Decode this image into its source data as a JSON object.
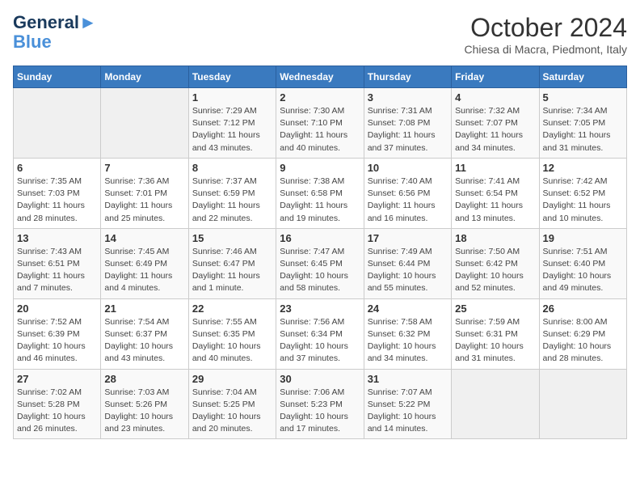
{
  "header": {
    "logo_line1": "General",
    "logo_line2": "Blue",
    "title": "October 2024",
    "location": "Chiesa di Macra, Piedmont, Italy"
  },
  "columns": [
    "Sunday",
    "Monday",
    "Tuesday",
    "Wednesday",
    "Thursday",
    "Friday",
    "Saturday"
  ],
  "weeks": [
    [
      {
        "day": "",
        "sunrise": "",
        "sunset": "",
        "daylight": ""
      },
      {
        "day": "",
        "sunrise": "",
        "sunset": "",
        "daylight": ""
      },
      {
        "day": "1",
        "sunrise": "Sunrise: 7:29 AM",
        "sunset": "Sunset: 7:12 PM",
        "daylight": "Daylight: 11 hours and 43 minutes."
      },
      {
        "day": "2",
        "sunrise": "Sunrise: 7:30 AM",
        "sunset": "Sunset: 7:10 PM",
        "daylight": "Daylight: 11 hours and 40 minutes."
      },
      {
        "day": "3",
        "sunrise": "Sunrise: 7:31 AM",
        "sunset": "Sunset: 7:08 PM",
        "daylight": "Daylight: 11 hours and 37 minutes."
      },
      {
        "day": "4",
        "sunrise": "Sunrise: 7:32 AM",
        "sunset": "Sunset: 7:07 PM",
        "daylight": "Daylight: 11 hours and 34 minutes."
      },
      {
        "day": "5",
        "sunrise": "Sunrise: 7:34 AM",
        "sunset": "Sunset: 7:05 PM",
        "daylight": "Daylight: 11 hours and 31 minutes."
      }
    ],
    [
      {
        "day": "6",
        "sunrise": "Sunrise: 7:35 AM",
        "sunset": "Sunset: 7:03 PM",
        "daylight": "Daylight: 11 hours and 28 minutes."
      },
      {
        "day": "7",
        "sunrise": "Sunrise: 7:36 AM",
        "sunset": "Sunset: 7:01 PM",
        "daylight": "Daylight: 11 hours and 25 minutes."
      },
      {
        "day": "8",
        "sunrise": "Sunrise: 7:37 AM",
        "sunset": "Sunset: 6:59 PM",
        "daylight": "Daylight: 11 hours and 22 minutes."
      },
      {
        "day": "9",
        "sunrise": "Sunrise: 7:38 AM",
        "sunset": "Sunset: 6:58 PM",
        "daylight": "Daylight: 11 hours and 19 minutes."
      },
      {
        "day": "10",
        "sunrise": "Sunrise: 7:40 AM",
        "sunset": "Sunset: 6:56 PM",
        "daylight": "Daylight: 11 hours and 16 minutes."
      },
      {
        "day": "11",
        "sunrise": "Sunrise: 7:41 AM",
        "sunset": "Sunset: 6:54 PM",
        "daylight": "Daylight: 11 hours and 13 minutes."
      },
      {
        "day": "12",
        "sunrise": "Sunrise: 7:42 AM",
        "sunset": "Sunset: 6:52 PM",
        "daylight": "Daylight: 11 hours and 10 minutes."
      }
    ],
    [
      {
        "day": "13",
        "sunrise": "Sunrise: 7:43 AM",
        "sunset": "Sunset: 6:51 PM",
        "daylight": "Daylight: 11 hours and 7 minutes."
      },
      {
        "day": "14",
        "sunrise": "Sunrise: 7:45 AM",
        "sunset": "Sunset: 6:49 PM",
        "daylight": "Daylight: 11 hours and 4 minutes."
      },
      {
        "day": "15",
        "sunrise": "Sunrise: 7:46 AM",
        "sunset": "Sunset: 6:47 PM",
        "daylight": "Daylight: 11 hours and 1 minute."
      },
      {
        "day": "16",
        "sunrise": "Sunrise: 7:47 AM",
        "sunset": "Sunset: 6:45 PM",
        "daylight": "Daylight: 10 hours and 58 minutes."
      },
      {
        "day": "17",
        "sunrise": "Sunrise: 7:49 AM",
        "sunset": "Sunset: 6:44 PM",
        "daylight": "Daylight: 10 hours and 55 minutes."
      },
      {
        "day": "18",
        "sunrise": "Sunrise: 7:50 AM",
        "sunset": "Sunset: 6:42 PM",
        "daylight": "Daylight: 10 hours and 52 minutes."
      },
      {
        "day": "19",
        "sunrise": "Sunrise: 7:51 AM",
        "sunset": "Sunset: 6:40 PM",
        "daylight": "Daylight: 10 hours and 49 minutes."
      }
    ],
    [
      {
        "day": "20",
        "sunrise": "Sunrise: 7:52 AM",
        "sunset": "Sunset: 6:39 PM",
        "daylight": "Daylight: 10 hours and 46 minutes."
      },
      {
        "day": "21",
        "sunrise": "Sunrise: 7:54 AM",
        "sunset": "Sunset: 6:37 PM",
        "daylight": "Daylight: 10 hours and 43 minutes."
      },
      {
        "day": "22",
        "sunrise": "Sunrise: 7:55 AM",
        "sunset": "Sunset: 6:35 PM",
        "daylight": "Daylight: 10 hours and 40 minutes."
      },
      {
        "day": "23",
        "sunrise": "Sunrise: 7:56 AM",
        "sunset": "Sunset: 6:34 PM",
        "daylight": "Daylight: 10 hours and 37 minutes."
      },
      {
        "day": "24",
        "sunrise": "Sunrise: 7:58 AM",
        "sunset": "Sunset: 6:32 PM",
        "daylight": "Daylight: 10 hours and 34 minutes."
      },
      {
        "day": "25",
        "sunrise": "Sunrise: 7:59 AM",
        "sunset": "Sunset: 6:31 PM",
        "daylight": "Daylight: 10 hours and 31 minutes."
      },
      {
        "day": "26",
        "sunrise": "Sunrise: 8:00 AM",
        "sunset": "Sunset: 6:29 PM",
        "daylight": "Daylight: 10 hours and 28 minutes."
      }
    ],
    [
      {
        "day": "27",
        "sunrise": "Sunrise: 7:02 AM",
        "sunset": "Sunset: 5:28 PM",
        "daylight": "Daylight: 10 hours and 26 minutes."
      },
      {
        "day": "28",
        "sunrise": "Sunrise: 7:03 AM",
        "sunset": "Sunset: 5:26 PM",
        "daylight": "Daylight: 10 hours and 23 minutes."
      },
      {
        "day": "29",
        "sunrise": "Sunrise: 7:04 AM",
        "sunset": "Sunset: 5:25 PM",
        "daylight": "Daylight: 10 hours and 20 minutes."
      },
      {
        "day": "30",
        "sunrise": "Sunrise: 7:06 AM",
        "sunset": "Sunset: 5:23 PM",
        "daylight": "Daylight: 10 hours and 17 minutes."
      },
      {
        "day": "31",
        "sunrise": "Sunrise: 7:07 AM",
        "sunset": "Sunset: 5:22 PM",
        "daylight": "Daylight: 10 hours and 14 minutes."
      },
      {
        "day": "",
        "sunrise": "",
        "sunset": "",
        "daylight": ""
      },
      {
        "day": "",
        "sunrise": "",
        "sunset": "",
        "daylight": ""
      }
    ]
  ]
}
